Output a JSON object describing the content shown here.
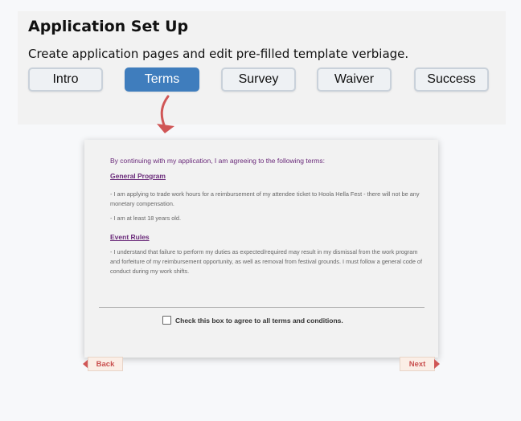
{
  "header": {
    "title": "Application Set Up",
    "subtitle": "Create application pages and edit pre-filled template verbiage."
  },
  "tabs": [
    {
      "label": "Intro",
      "active": false
    },
    {
      "label": "Terms",
      "active": true
    },
    {
      "label": "Survey",
      "active": false
    },
    {
      "label": "Waiver",
      "active": false
    },
    {
      "label": "Success",
      "active": false
    }
  ],
  "terms": {
    "intro": "By continuing with my application, I am agreeing to the following terms:",
    "sections": [
      {
        "heading": "General Program",
        "paragraphs": [
          "- I am applying to trade work hours for a reimbursement of my attendee ticket to Hoola Hella Fest - there will not be any monetary compensation.",
          "- I am at least 18 years old."
        ]
      },
      {
        "heading": "Event Rules",
        "paragraphs": [
          "- I understand that failure to perform my duties as expected/required may result in my dismissal from the work program and forfeiture of my reimbursement opportunity, as well as removal from festival grounds.  I must follow a general code of conduct during my work shifts."
        ]
      }
    ],
    "agree_label": "Check this box to agree to all terms and conditions.",
    "agree_checked": false
  },
  "navigation": {
    "back_label": "Back",
    "next_label": "Next"
  },
  "colors": {
    "active_tab": "#3f7dbd",
    "accent_purple": "#6a2a7a",
    "arrow_red": "#d05656",
    "nav_text": "#c9504f"
  }
}
